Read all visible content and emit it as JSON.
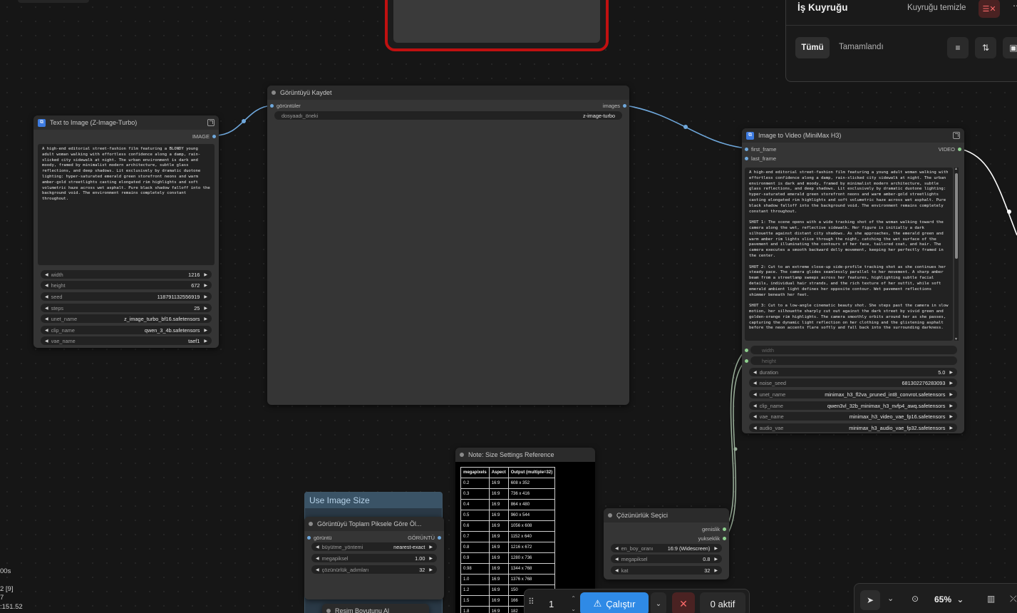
{
  "queue": {
    "title": "İş Kuyruğu",
    "clear_label": "Kuyruğu temizle",
    "tabs": [
      "Tümü",
      "Tamamlandı"
    ]
  },
  "save_node": {
    "title": "Görüntüyü Kaydet",
    "input": "görüntüler",
    "output": "images",
    "widget_label": "dosyaadı_öneki",
    "widget_value": "z-image-turbo"
  },
  "t2i_node": {
    "title": "Text to Image (Z-Image-Turbo)",
    "output": "IMAGE",
    "prompt": "A high-end editorial street-fashion film featuring a BLONDY young adult woman walking with effortless confidence along a damp, rain-slicked city sidewalk at night. The urban environment is dark and moody, framed by minimalist modern architecture, subtle glass reflections, and deep shadows. Lit exclusively by dramatic duotone lighting: hyper-saturated emerald green storefront neons and warm amber-gold streetlights casting elongated rim highlights and soft volumetric haze across wet asphalt. Pure black shadow falloff into the background void. The environment remains completely constant throughout.",
    "widgets": [
      {
        "label": "width",
        "value": "1216"
      },
      {
        "label": "height",
        "value": "672"
      },
      {
        "label": "seed",
        "value": "118791132556919"
      },
      {
        "label": "steps",
        "value": "25"
      },
      {
        "label": "unet_name",
        "value": "z_image_turbo_bf16.safetensors"
      },
      {
        "label": "clip_name",
        "value": "qwen_3_4b.safetensors"
      },
      {
        "label": "vae_name",
        "value": "taef1"
      }
    ]
  },
  "i2v_node": {
    "title": "Image to Video (MiniMax H3)",
    "inputs": [
      "first_frame",
      "last_frame"
    ],
    "output": "VIDEO",
    "prompt": "A high-end editorial street-fashion film featuring a young adult woman walking with effortless confidence along a damp, rain-slicked city sidewalk at night. The urban environment is dark and moody, framed by minimalist modern architecture, subtle glass reflections, and deep shadows. Lit exclusively by dramatic duotone lighting: hyper-saturated emerald green storefront neons and warm amber-gold streetlights casting elongated rim highlights and soft volumetric haze across wet asphalt. Pure black shadow falloff into the background void. The environment remains completely constant throughout.\n\nSHOT 1: The scene opens with a wide tracking shot of the woman walking toward the camera along the wet, reflective sidewalk. Her figure is initially a dark silhouette against distant city shadows. As she approaches, the emerald green and warm amber rim lights slice through the night, catching the wet surface of the pavement and illuminating the contours of her face, tailored coat, and hair. The camera executes a smooth backward dolly movement, keeping her perfectly framed in the center.\n\nSHOT 2: Cut to an extreme close-up side-profile tracking shot as she continues her steady pace. The camera glides seamlessly parallel to her movement. A sharp amber beam from a streetlamp sweeps across her features, highlighting subtle facial details, individual hair strands, and the rich texture of her outfit, while soft emerald ambient light defines her opposite contour. Wet pavement reflections shimmer beneath her feet.\n\nSHOT 3: Cut to a low-angle cinematic beauty shot. She steps past the camera in slow motion, her silhouette sharply cut out against the dark street by vivid green and golden-orange rim highlights. The camera smoothly orbits around her as she passes, capturing the dynamic light reflection on her clothing and the glistening asphalt before the neon accents flare softly and fall back into the surrounding darkness.",
    "linked": [
      "width",
      "height"
    ],
    "widgets": [
      {
        "label": "duration",
        "value": "5.0"
      },
      {
        "label": "noise_seed",
        "value": "681302276283093"
      },
      {
        "label": "unet_name",
        "value": "minimax_h3_fl2va_pruned_int8_convrot.safetensors"
      },
      {
        "label": "clip_name",
        "value": "qwen3vl_32b_minimax_h3_nvfp4_awq.safetensors"
      },
      {
        "label": "vae_name",
        "value": "minimax_h3_video_vae_fp16.safetensors"
      },
      {
        "label": "audio_vae",
        "value": "minimax_h3_audio_vae_fp32.safetensors"
      }
    ]
  },
  "note_node": {
    "title": "Note: Size Settings Reference",
    "headers": [
      "megapixels",
      "Aspect",
      "Output (multiple=32)"
    ],
    "rows": [
      [
        "0.2",
        "16:9",
        "608 x 352"
      ],
      [
        "0.3",
        "16:9",
        "736 x 416"
      ],
      [
        "0.4",
        "16:9",
        "864 x 480"
      ],
      [
        "0.5",
        "16:9",
        "960 x 544"
      ],
      [
        "0.6",
        "16:9",
        "1056 x 608"
      ],
      [
        "0.7",
        "16:9",
        "1152 x 640"
      ],
      [
        "0.8",
        "16:9",
        "1216 x 672"
      ],
      [
        "0.9",
        "16:9",
        "1280 x 736"
      ],
      [
        "0.98",
        "16:9",
        "1344 x 768"
      ],
      [
        "1.0",
        "16:9",
        "1376 x 768"
      ],
      [
        "1.2",
        "16:9",
        "150"
      ],
      [
        "1.5",
        "16:9",
        "166"
      ],
      [
        "1.8",
        "16:9",
        "182"
      ]
    ]
  },
  "group": {
    "title": "Use Image Size"
  },
  "scale_node": {
    "title": "Görüntüyü Toplam Piksele Göre Öl...",
    "input": "görüntü",
    "output": "GÖRÜNTÜ",
    "widgets": [
      {
        "label": "büyütme_yöntemi",
        "value": "nearest-exact"
      },
      {
        "label": "megapiksel",
        "value": "1.00"
      },
      {
        "label": "çözünürlük_adımları",
        "value": "32"
      }
    ]
  },
  "size_node": {
    "title": "Resim Boyutunu Al"
  },
  "res_node": {
    "title": "Çözünürlük Seçici",
    "outputs": [
      "genislik",
      "yukseklik"
    ],
    "widgets": [
      {
        "label": "en_boy_oranı",
        "value": "16:9 (Widescreen)"
      },
      {
        "label": "megapiksel",
        "value": "0.8"
      },
      {
        "label": "kat",
        "value": "32"
      }
    ]
  },
  "toolbar": {
    "count": "1",
    "run_label": "Çalıştır",
    "active_label": "0 aktif"
  },
  "zoom": {
    "level": "65%"
  },
  "stats": {
    "line1": "00s",
    "line2": "2 [9]",
    "line3": "7",
    "line4": ":151.52"
  },
  "colors": {
    "link_image": "#6fa8dc",
    "link_video": "#ffffff",
    "link_int": "#9ab09a",
    "run_button": "#2f8ae6",
    "selected_border": "#c01010"
  }
}
